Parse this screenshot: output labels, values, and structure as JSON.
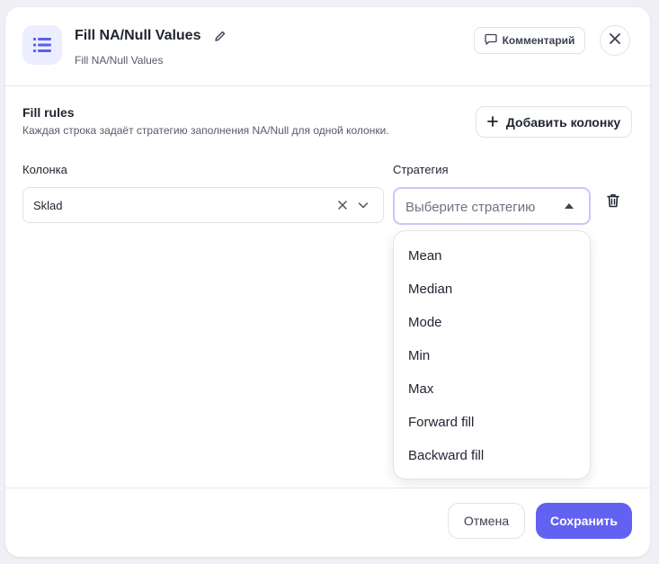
{
  "header": {
    "title": "Fill NA/Null Values",
    "subtitle": "Fill NA/Null Values",
    "comment_label": "Комментарий",
    "node_icon": "list-icon",
    "accent_color": "#6161f2"
  },
  "rules": {
    "title": "Fill rules",
    "description": "Каждая строка задаёт стратегию заполнения NA/Null для одной колонки.",
    "add_column_label": "Добавить колонку",
    "column_header": "Колонка",
    "strategy_header": "Стратегия",
    "rows": [
      {
        "column_value": "Sklad",
        "strategy_placeholder": "Выберите стратегию"
      }
    ]
  },
  "strategy_options": [
    "Mean",
    "Median",
    "Mode",
    "Min",
    "Max",
    "Forward fill",
    "Backward fill"
  ],
  "footer": {
    "cancel_label": "Отмена",
    "save_label": "Сохранить"
  }
}
